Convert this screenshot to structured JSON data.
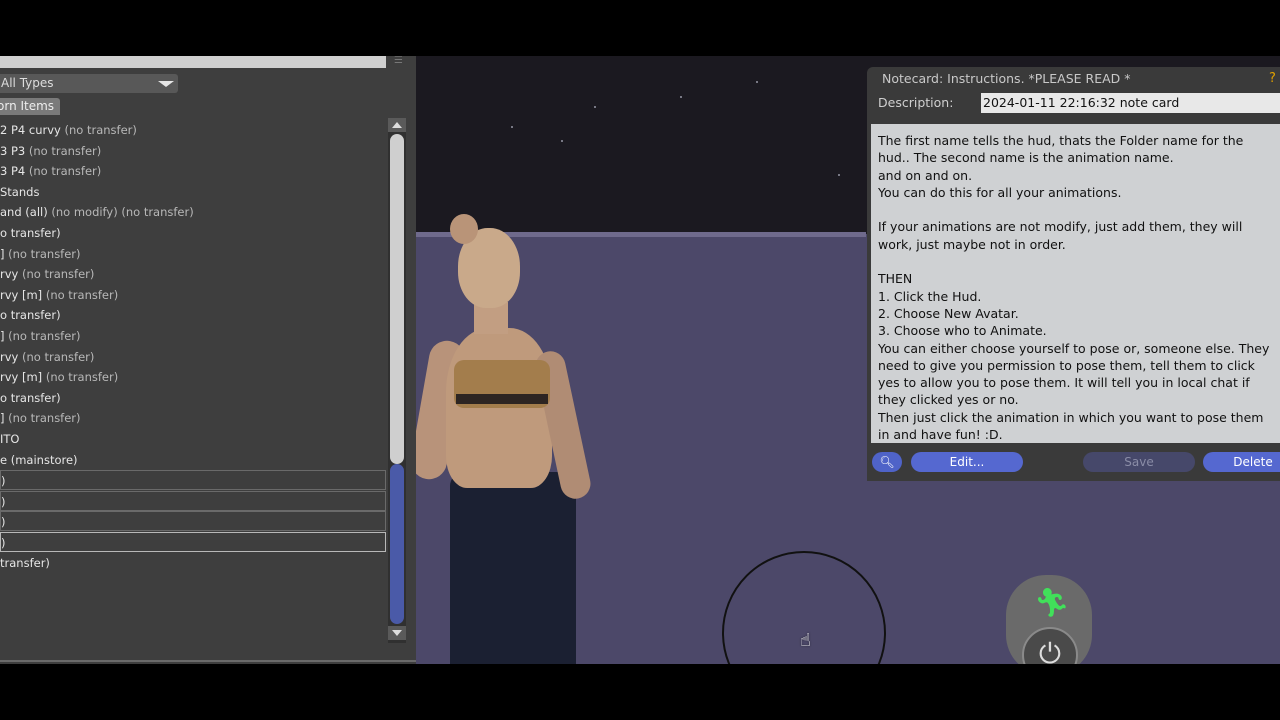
{
  "inventory": {
    "filter_value": "All Types",
    "tab_label": "orn Items",
    "rows": [
      {
        "name": "2 P4 curvy",
        "note": "(no transfer)"
      },
      {
        "name": "3 P3",
        "note": "(no transfer)"
      },
      {
        "name": "3 P4",
        "note": "(no transfer)"
      },
      {
        "name": "Stands",
        "note": ""
      },
      {
        "name": "and (all)",
        "note": "(no modify) (no transfer)"
      },
      {
        "name": "o transfer)",
        "note": ""
      },
      {
        "name": "]",
        "note": "(no transfer)"
      },
      {
        "name": "rvy",
        "note": "(no transfer)"
      },
      {
        "name": "rvy [m]",
        "note": "(no transfer)"
      },
      {
        "name": "o transfer)",
        "note": ""
      },
      {
        "name": "]",
        "note": "(no transfer)"
      },
      {
        "name": "rvy",
        "note": "(no transfer)"
      },
      {
        "name": "rvy [m]",
        "note": "(no transfer)"
      },
      {
        "name": "o transfer)",
        "note": ""
      },
      {
        "name": "]",
        "note": "(no transfer)"
      },
      {
        "name": "ITO",
        "note": ""
      },
      {
        "name": "e (mainstore)",
        "note": ""
      },
      {
        "name": ")",
        "note": ""
      },
      {
        "name": ")",
        "note": ""
      },
      {
        "name": ")",
        "note": ""
      },
      {
        "name": ")",
        "note": ""
      },
      {
        "name": "transfer)",
        "note": ""
      }
    ]
  },
  "notecard": {
    "title": "Notecard: Instructions. *PLEASE READ *",
    "help": "?",
    "description_label": "Description:",
    "description_value": "2024-01-11 22:16:32 note card",
    "body": "The first name tells the hud, thats the Folder name for the\nhud.. The second name is the animation name.\nand on and on.\nYou can do this for all your animations.\n\nIf your animations are not modify, just add them, they will\nwork, just maybe not in order.\n\nTHEN\n1. Click the Hud.\n2. Choose New Avatar.\n3. Choose who to Animate.\nYou can either choose yourself to pose or, someone else. They\nneed to give you permission to pose them, tell them to click\nyes to allow you to pose them. It will tell you in local chat if\nthey clicked yes or no.\nThen just click the animation in which you want to pose them\nin and have fun! :D.",
    "buttons": {
      "edit": "Edit...",
      "save": "Save",
      "delete": "Delete"
    }
  },
  "icons": {
    "search": "search-icon",
    "walk": "walk-icon",
    "power": "power-icon",
    "cursor": "hand-cursor-icon"
  },
  "colors": {
    "panel_bg": "#3e3e3e",
    "accent_blue": "#5568d0",
    "scene_ground": "#4c4869",
    "walk_green": "#41e05a"
  }
}
